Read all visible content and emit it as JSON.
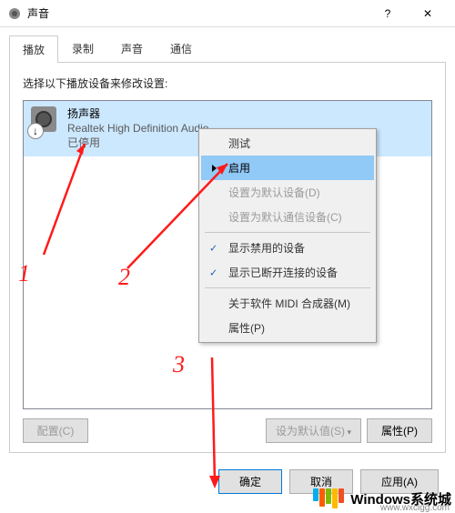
{
  "window": {
    "title": "声音",
    "help_label": "?",
    "close_label": "✕"
  },
  "tabs": [
    {
      "label": "播放",
      "active": true
    },
    {
      "label": "录制",
      "active": false
    },
    {
      "label": "声音",
      "active": false
    },
    {
      "label": "通信",
      "active": false
    }
  ],
  "instruction": "选择以下播放设备来修改设置:",
  "device": {
    "name": "扬声器",
    "description": "Realtek High Definition Audio",
    "status": "已停用",
    "badge": "↓"
  },
  "context_menu": {
    "items": [
      {
        "label": "测试",
        "type": "normal"
      },
      {
        "label": "启用",
        "type": "highlight"
      },
      {
        "label": "设置为默认设备(D)",
        "type": "disabled"
      },
      {
        "label": "设置为默认通信设备(C)",
        "type": "disabled"
      },
      {
        "label": "sep",
        "type": "sep"
      },
      {
        "label": "显示禁用的设备",
        "type": "checked"
      },
      {
        "label": "显示已断开连接的设备",
        "type": "checked"
      },
      {
        "label": "sep",
        "type": "sep"
      },
      {
        "label": "关于软件 MIDI 合成器(M)",
        "type": "normal"
      },
      {
        "label": "属性(P)",
        "type": "normal"
      }
    ]
  },
  "bottom_buttons": {
    "configure": "配置(C)",
    "set_default": "设为默认值(S)",
    "properties": "属性(P)"
  },
  "dialog_buttons": {
    "ok": "确定",
    "cancel": "取消",
    "apply": "应用(A)"
  },
  "annotations": {
    "num1": "1",
    "num2": "2",
    "num3": "3"
  },
  "watermark": {
    "text": "Windows系统城",
    "url": "www.wxclgg.com"
  }
}
